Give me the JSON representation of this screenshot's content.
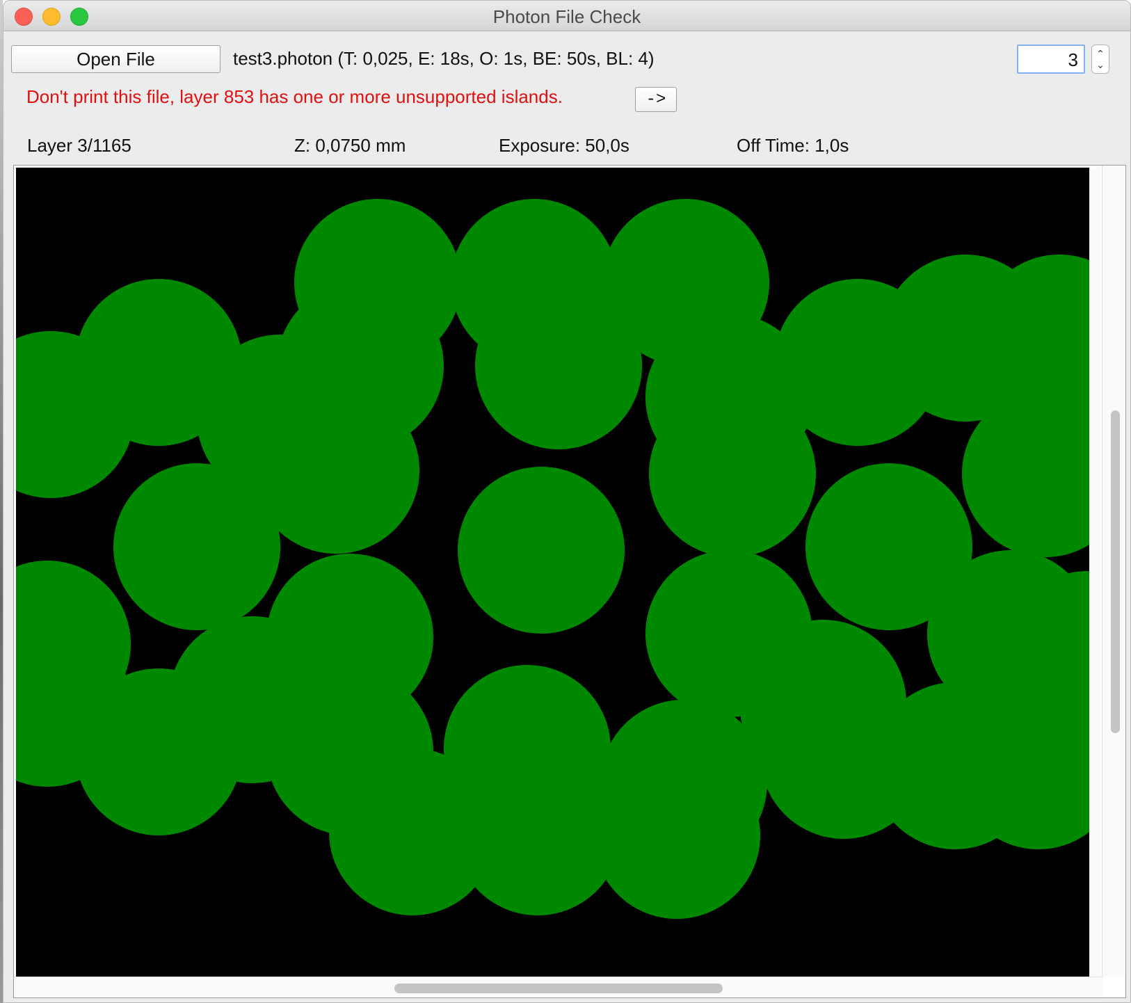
{
  "window": {
    "title": "Photon File Check"
  },
  "toolbar": {
    "open_file_label": "Open File",
    "file_info": "test3.photon (T: 0,025, E: 18s, O: 1s, BE: 50s, BL: 4)",
    "layer_input_value": "3"
  },
  "warning": {
    "message": "Don't print this file, layer 853 has one or more unsupported islands.",
    "goto_label": "->"
  },
  "status": {
    "layer": "Layer 3/1165",
    "z": "Z: 0,0750 mm",
    "exposure": "Exposure: 50,0s",
    "off_time": "Off Time: 1,0s"
  },
  "colors": {
    "layer_fill": "#008800",
    "background": "#000000",
    "warning": "#e01010"
  }
}
